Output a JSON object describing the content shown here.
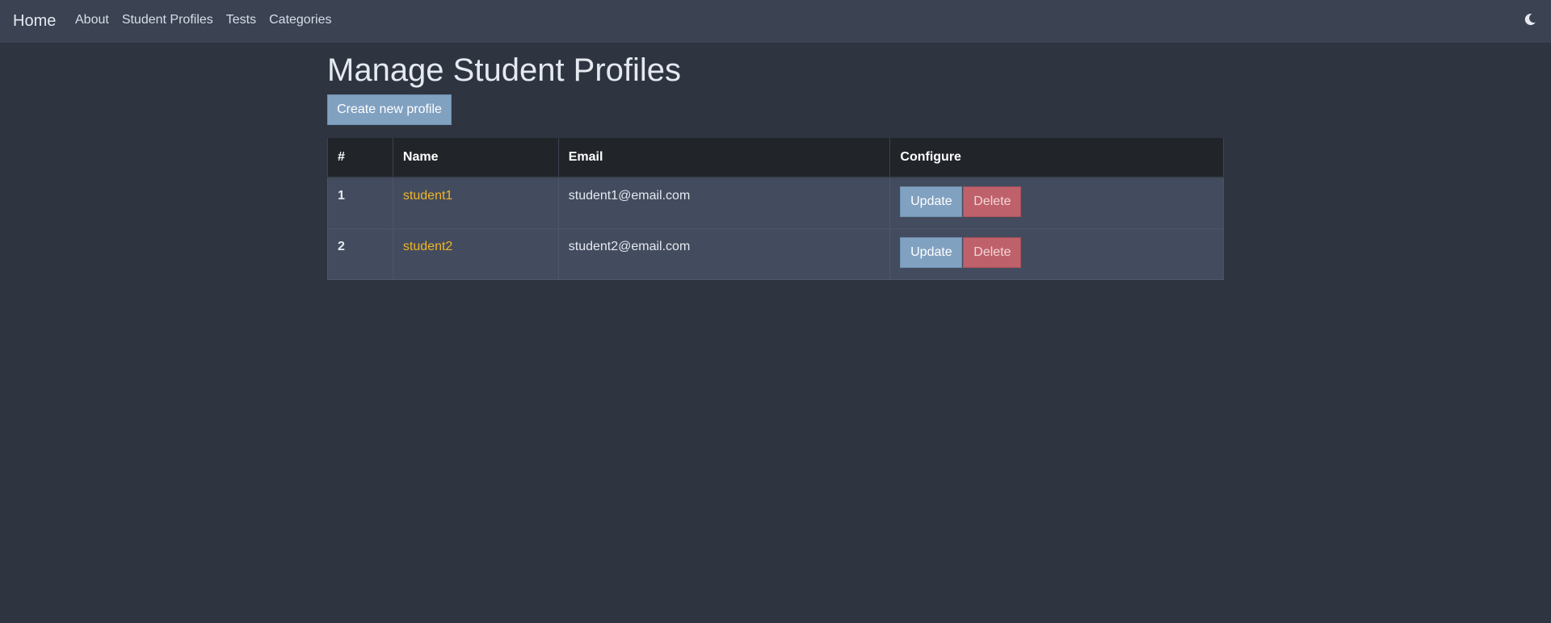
{
  "navbar": {
    "brand": "Home",
    "links": [
      "About",
      "Student Profiles",
      "Tests",
      "Categories"
    ],
    "theme_icon": "moon-icon"
  },
  "page": {
    "title": "Manage Student Profiles",
    "create_button": "Create new profile"
  },
  "table": {
    "headers": [
      "#",
      "Name",
      "Email",
      "Configure"
    ],
    "rows": [
      {
        "index": "1",
        "name": "student1",
        "email": "student1@email.com",
        "update": "Update",
        "delete": "Delete"
      },
      {
        "index": "2",
        "name": "student2",
        "email": "student2@email.com",
        "update": "Update",
        "delete": "Delete"
      }
    ]
  },
  "colors": {
    "background": "#2e3440",
    "navbar": "#3b4252",
    "primary_button": "#81a1c1",
    "danger_button": "#bf616a",
    "link": "#f0b429"
  }
}
